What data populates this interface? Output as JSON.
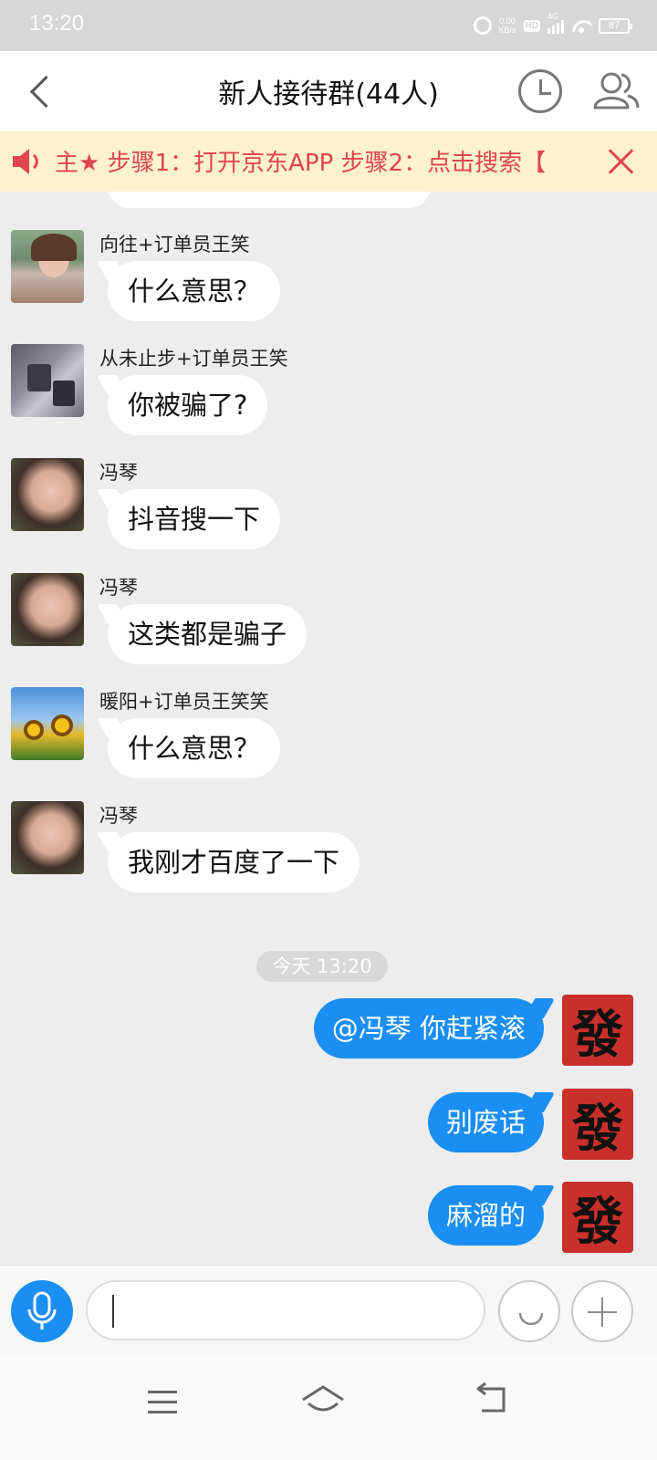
{
  "status_bar": {
    "time": "13:20",
    "net_speed_value": "0.00",
    "net_speed_unit": "KB/s",
    "hd_label": "HD",
    "network_label": "4G",
    "battery": "87"
  },
  "header": {
    "title": "新人接待群(44人)"
  },
  "announcement": {
    "text": "主★  步骤1：打开京东APP  步骤2：点击搜索【"
  },
  "messages": [
    {
      "sender": "向往+订单员王笑",
      "text": "什么意思？"
    },
    {
      "sender": "从未止步+订单员王笑",
      "text": "你被骗了?"
    },
    {
      "sender": "冯琴",
      "text": "抖音搜一下"
    },
    {
      "sender": "冯琴",
      "text": "这类都是骗子"
    },
    {
      "sender": "暖阳+订单员王笑笑",
      "text": "什么意思？"
    },
    {
      "sender": "冯琴",
      "text": "我刚才百度了一下"
    }
  ],
  "time_divider": "今天 13:20",
  "my_messages": [
    {
      "text": "@冯琴 你赶紧滚"
    },
    {
      "text": "别废话"
    },
    {
      "text": "麻溜的"
    }
  ],
  "my_avatar_char": "發",
  "input": {
    "value": "",
    "placeholder": ""
  },
  "colors": {
    "accent_blue": "#1a8ef3",
    "announce_red": "#e0454c",
    "announce_bg": "#fdf1d0",
    "chat_bg": "#ededed"
  }
}
